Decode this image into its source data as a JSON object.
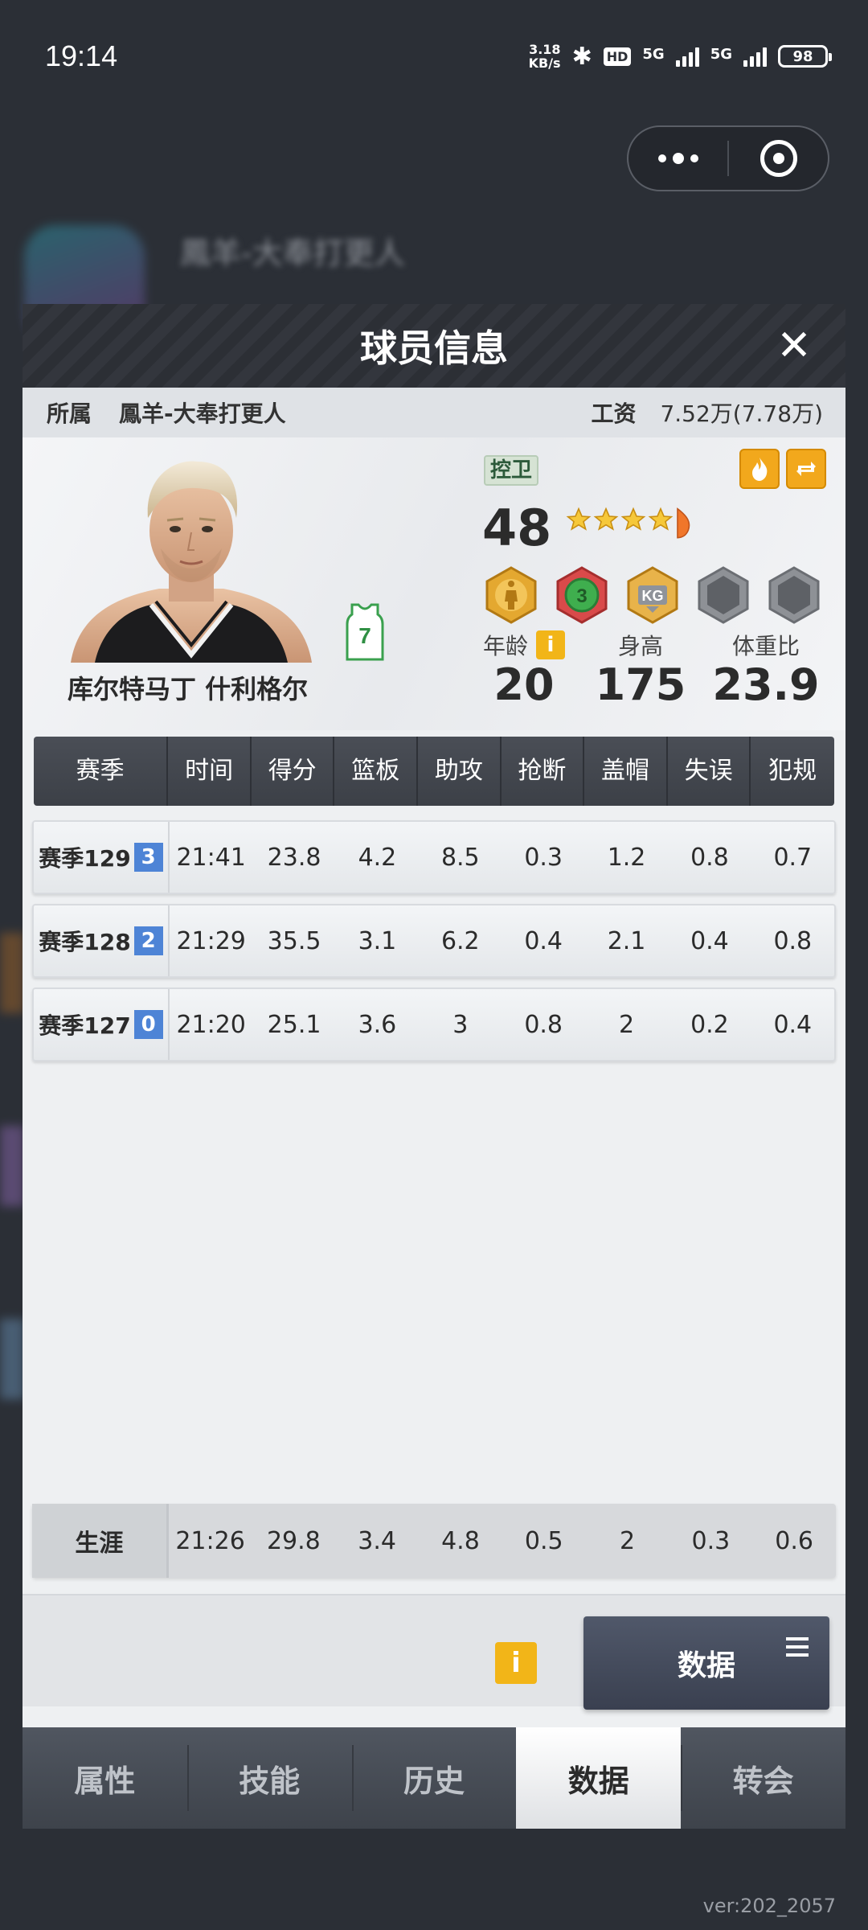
{
  "status_bar": {
    "time": "19:14",
    "net_speed_value": "3.18",
    "net_speed_unit": "KB/s",
    "hd_label": "HD",
    "net1": "5G",
    "net2": "5G",
    "battery": "98"
  },
  "background": {
    "team_name": "鳳羊-大奉打更人",
    "version": "ver:202_2057"
  },
  "modal": {
    "title": "球员信息",
    "close_icon": "close-icon",
    "team_label": "所属",
    "team_name": "鳳羊-大奉打更人",
    "salary_label": "工资",
    "salary_value": "7.52万(7.78万)"
  },
  "player": {
    "name": "库尔特马丁 什利格尔",
    "jersey_number": "7",
    "position": "控卫",
    "rating": "48",
    "stars": 4.5,
    "age_label": "年龄",
    "age": "20",
    "height_label": "身高",
    "height": "175",
    "weight_ratio_label": "体重比",
    "weight_ratio": "23.9",
    "info_glyph": "i"
  },
  "table": {
    "headers": [
      "赛季",
      "时间",
      "得分",
      "篮板",
      "助攻",
      "抢断",
      "盖帽",
      "失误",
      "犯规"
    ],
    "rows": [
      {
        "season": "赛季129",
        "badge": "3",
        "values": [
          "21:41",
          "23.8",
          "4.2",
          "8.5",
          "0.3",
          "1.2",
          "0.8",
          "0.7"
        ]
      },
      {
        "season": "赛季128",
        "badge": "2",
        "values": [
          "21:29",
          "35.5",
          "3.1",
          "6.2",
          "0.4",
          "2.1",
          "0.4",
          "0.8"
        ]
      },
      {
        "season": "赛季127",
        "badge": "0",
        "values": [
          "21:20",
          "25.1",
          "3.6",
          "3",
          "0.8",
          "2",
          "0.2",
          "0.4"
        ]
      }
    ],
    "career": {
      "label": "生涯",
      "values": [
        "21:26",
        "29.8",
        "3.4",
        "4.8",
        "0.5",
        "2",
        "0.3",
        "0.6"
      ]
    }
  },
  "actions": {
    "info_glyph": "i",
    "data_button": "数据"
  },
  "tabs": [
    {
      "label": "属性"
    },
    {
      "label": "技能"
    },
    {
      "label": "历史"
    },
    {
      "label": "数据",
      "active": true
    },
    {
      "label": "转会"
    }
  ],
  "colors": {
    "accent_gold": "#f2b518",
    "season_badge": "#4e84d6",
    "header_dark": "#3c4047"
  }
}
